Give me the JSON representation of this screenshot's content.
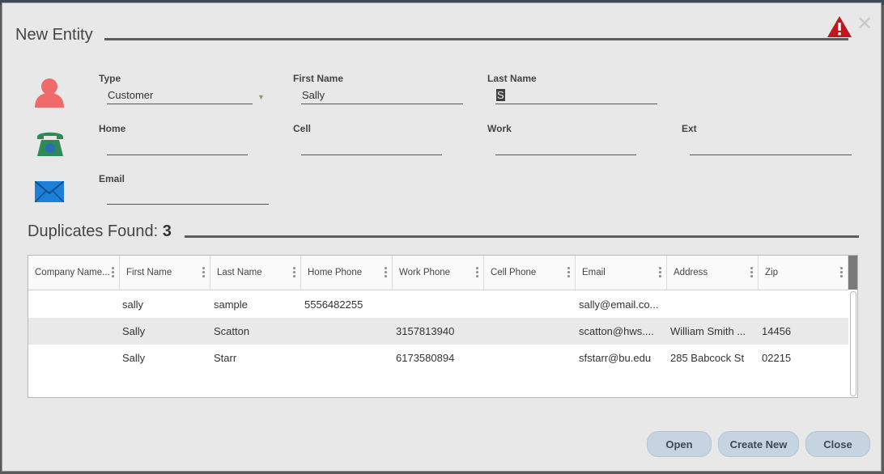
{
  "dialog": {
    "title": "New Entity",
    "colors": {
      "title_rule": "#5c5c5c",
      "warning": "#c0161d",
      "button": "#c6d3e0"
    }
  },
  "form": {
    "type": {
      "label": "Type",
      "value": "Customer"
    },
    "first_name": {
      "label": "First Name",
      "value": "Sally"
    },
    "last_name": {
      "label": "Last Name",
      "value": "S"
    },
    "home": {
      "label": "Home",
      "value": ""
    },
    "cell": {
      "label": "Cell",
      "value": ""
    },
    "work": {
      "label": "Work",
      "value": ""
    },
    "ext": {
      "label": "Ext",
      "value": ""
    },
    "email": {
      "label": "Email",
      "value": ""
    },
    "icons": [
      "person-icon",
      "telephone-icon",
      "envelope-icon"
    ]
  },
  "duplicates": {
    "title": "Duplicates Found:",
    "count": "3",
    "columns": [
      "Company Name...",
      "First Name",
      "Last Name",
      "Home Phone",
      "Work Phone",
      "Cell Phone",
      "Email",
      "Address",
      "Zip"
    ],
    "rows": [
      [
        "",
        "sally",
        "sample",
        "5556482255",
        "",
        "",
        "sally@email.co...",
        "",
        ""
      ],
      [
        "",
        "Sally",
        "Scatton",
        "",
        "3157813940",
        "",
        "scatton@hws....",
        "William Smith ...",
        "14456"
      ],
      [
        "",
        "Sally",
        "Starr",
        "",
        "6173580894",
        "",
        "sfstarr@bu.edu",
        "285 Babcock St",
        "02215"
      ]
    ]
  },
  "buttons": {
    "open": "Open",
    "create_new": "Create New",
    "close": "Close"
  }
}
